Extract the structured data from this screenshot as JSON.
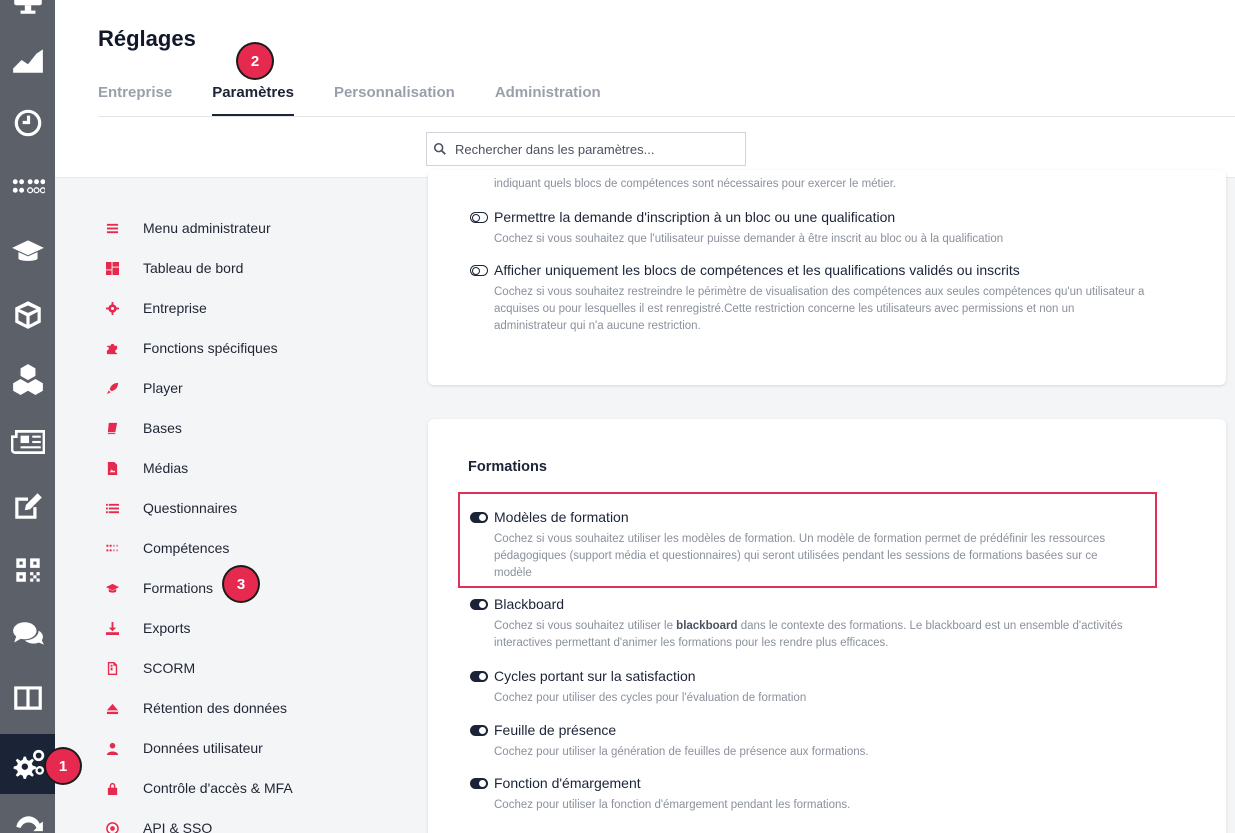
{
  "rail": {
    "items": [
      {
        "icon": "monitor-icon"
      },
      {
        "icon": "chart-area-icon"
      },
      {
        "icon": "clock-icon"
      },
      {
        "icon": "dots-grid-icon"
      },
      {
        "icon": "graduation-cap-icon"
      },
      {
        "icon": "cube-icon"
      },
      {
        "icon": "cubes-icon"
      },
      {
        "icon": "newspaper-icon"
      },
      {
        "icon": "edit-icon"
      },
      {
        "icon": "qrcode-icon"
      },
      {
        "icon": "comments-icon"
      },
      {
        "icon": "columns-icon"
      },
      {
        "icon": "cogs-icon",
        "active": true
      },
      {
        "icon": "sync-icon"
      }
    ]
  },
  "header": {
    "title": "Réglages",
    "tabs": [
      {
        "label": "Entreprise"
      },
      {
        "label": "Paramètres",
        "active": true
      },
      {
        "label": "Personnalisation"
      },
      {
        "label": "Administration"
      }
    ],
    "search_placeholder": "Rechercher dans les paramètres..."
  },
  "badges": [
    "1",
    "2",
    "3"
  ],
  "menu": {
    "items": [
      {
        "label": "Menu administrateur",
        "icon": "bars-icon"
      },
      {
        "label": "Tableau de bord",
        "icon": "dashboard-icon"
      },
      {
        "label": "Entreprise",
        "icon": "cog-icon"
      },
      {
        "label": "Fonctions spécifiques",
        "icon": "puzzle-icon"
      },
      {
        "label": "Player",
        "icon": "rocket-icon"
      },
      {
        "label": "Bases",
        "icon": "book-icon"
      },
      {
        "label": "Médias",
        "icon": "image-file-icon"
      },
      {
        "label": "Questionnaires",
        "icon": "list-icon"
      },
      {
        "label": "Compétences",
        "icon": "dots-grid-icon"
      },
      {
        "label": "Formations",
        "icon": "graduation-cap-icon"
      },
      {
        "label": "Exports",
        "icon": "download-icon"
      },
      {
        "label": "SCORM",
        "icon": "zip-file-icon"
      },
      {
        "label": "Rétention des données",
        "icon": "eject-icon"
      },
      {
        "label": "Données utilisateur",
        "icon": "user-icon"
      },
      {
        "label": "Contrôle d'accès & MFA",
        "icon": "lock-icon"
      },
      {
        "label": "API & SSO",
        "icon": "api-icon"
      }
    ]
  },
  "top_card": {
    "partial_text": "indiquant quels blocs de compétences sont nécessaires pour exercer le métier.",
    "options": [
      {
        "title": "Permettre la demande d'inscription à un bloc ou une qualification",
        "desc": "Cochez si vous souhaitez que l'utilisateur puisse demander à être inscrit au bloc ou à la qualification",
        "enabled": false
      },
      {
        "title": "Afficher uniquement les blocs de compétences et les qualifications validés ou inscrits",
        "desc": "Cochez si vous souhaitez restreindre le périmètre de visualisation des compétences aux seules compétences qu'un utilisateur a acquises ou pour lesquelles il est renregistré.Cette restriction concerne les utilisateurs avec permissions et non un administrateur qui n'a aucune restriction.",
        "enabled": false
      }
    ]
  },
  "formations_card": {
    "title": "Formations",
    "options": [
      {
        "title": "Modèles de formation",
        "desc": "Cochez si vous souhaitez utiliser les modèles de formation. Un modèle de formation permet de prédéfinir les ressources pédagogiques (support média et questionnaires) qui seront utilisées pendant les sessions de formations basées sur ce modèle",
        "enabled": true
      },
      {
        "title": "Blackboard",
        "desc_pre": "Cochez si vous souhaitez utiliser le ",
        "desc_bold": "blackboard",
        "desc_post": " dans le contexte des formations. Le blackboard est un ensemble d'activités interactives permettant d'animer les formations pour les rendre plus efficaces.",
        "enabled": true
      },
      {
        "title": "Cycles portant sur la satisfaction",
        "desc": "Cochez pour utiliser des cycles pour l'évaluation de formation",
        "enabled": true
      },
      {
        "title": "Feuille de présence",
        "desc": "Cochez pour utiliser la génération de feuilles de présence aux formations.",
        "enabled": true
      },
      {
        "title": "Fonction d'émargement",
        "desc": "Cochez pour utiliser la fonction d'émargement pendant les formations.",
        "enabled": true
      }
    ]
  },
  "colors": {
    "accent": "#e6294f",
    "navy": "#1b2436",
    "rail": "#5b6069"
  }
}
